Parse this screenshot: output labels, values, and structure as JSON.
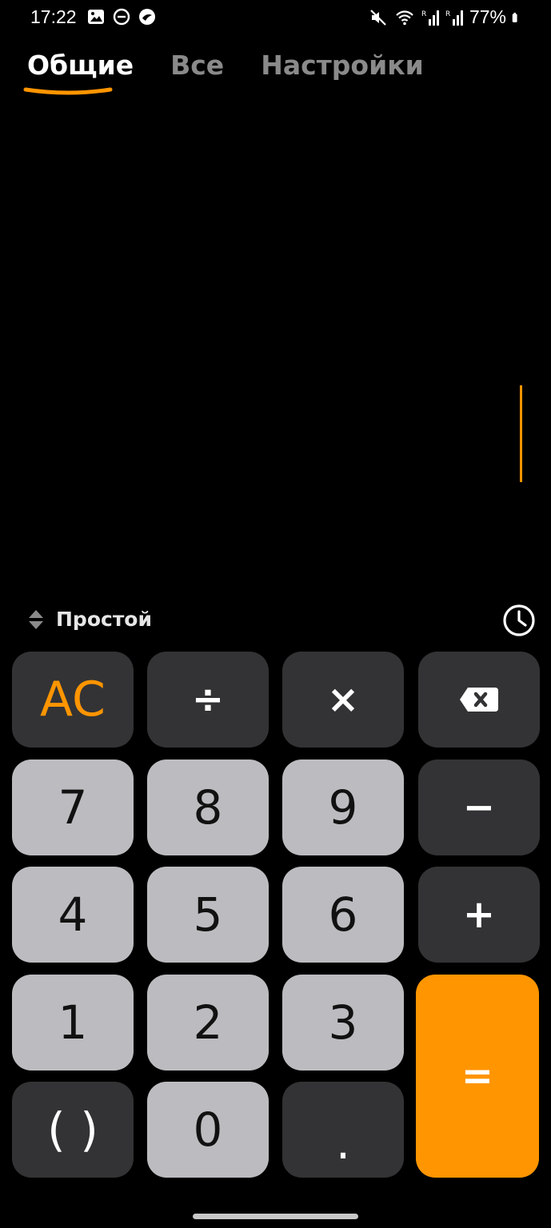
{
  "status_bar": {
    "time": "17:22",
    "battery": "77%",
    "left_icons": [
      "image-icon",
      "do-not-disturb-icon",
      "app-notification-icon"
    ],
    "right_icons": [
      "mute-icon",
      "wifi-icon",
      "signal-r-icon",
      "signal-r-icon",
      "battery-icon"
    ]
  },
  "tabs": [
    {
      "label": "Общие",
      "active": true
    },
    {
      "label": "Все",
      "active": false
    },
    {
      "label": "Настройки",
      "active": false
    }
  ],
  "mode": {
    "label": "Простой"
  },
  "keys": {
    "ac": "AC",
    "divide": "÷",
    "multiply": "×",
    "backspace": "⌫",
    "seven": "7",
    "eight": "8",
    "nine": "9",
    "minus": "−",
    "four": "4",
    "five": "5",
    "six": "6",
    "plus": "+",
    "one": "1",
    "two": "2",
    "three": "3",
    "equals": "=",
    "parens": "( )",
    "zero": "0",
    "dot": "."
  },
  "colors": {
    "accent": "#ff9500",
    "key_dark": "#333335",
    "key_light": "#bcbcc0",
    "background": "#000000"
  }
}
